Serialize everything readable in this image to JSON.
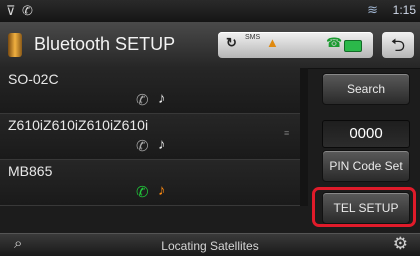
{
  "status_bar": {
    "left_icon_1": "mic-icon",
    "left_icon_2": "phone-signal-icon",
    "wifi_icon": "wifi-icon",
    "time": "1:15"
  },
  "header": {
    "title": "Bluetooth SETUP",
    "status_icons": [
      "rotate-icon",
      "sms-icon",
      "signal-bars-icon",
      "call-icon",
      "battery-icon"
    ],
    "status_sms": "SMS",
    "back_icon": "back-arrow-icon"
  },
  "devices": [
    {
      "name": "SO-02C",
      "phone_color": "#a6a6a6",
      "music_color": "#e8e8e8"
    },
    {
      "name": "Z610iZ610iZ610iZ610i",
      "phone_color": "#a6a6a6",
      "music_color": "#e8e8e8"
    },
    {
      "name": "MB865",
      "phone_color": "#20c83a",
      "music_color": "#ff8a10"
    }
  ],
  "buttons": {
    "search": "Search",
    "pin_value": "0000",
    "pin_set": "PIN Code Set",
    "tel_setup": "TEL SETUP"
  },
  "bottom_bar": {
    "left_icon": "nav-search-icon",
    "status_text": "Locating Satellites",
    "right_icon": "gear-icon"
  },
  "colors": {
    "highlight": "#e01b2a",
    "connected_phone": "#20c83a",
    "connected_music": "#ff8a10"
  }
}
